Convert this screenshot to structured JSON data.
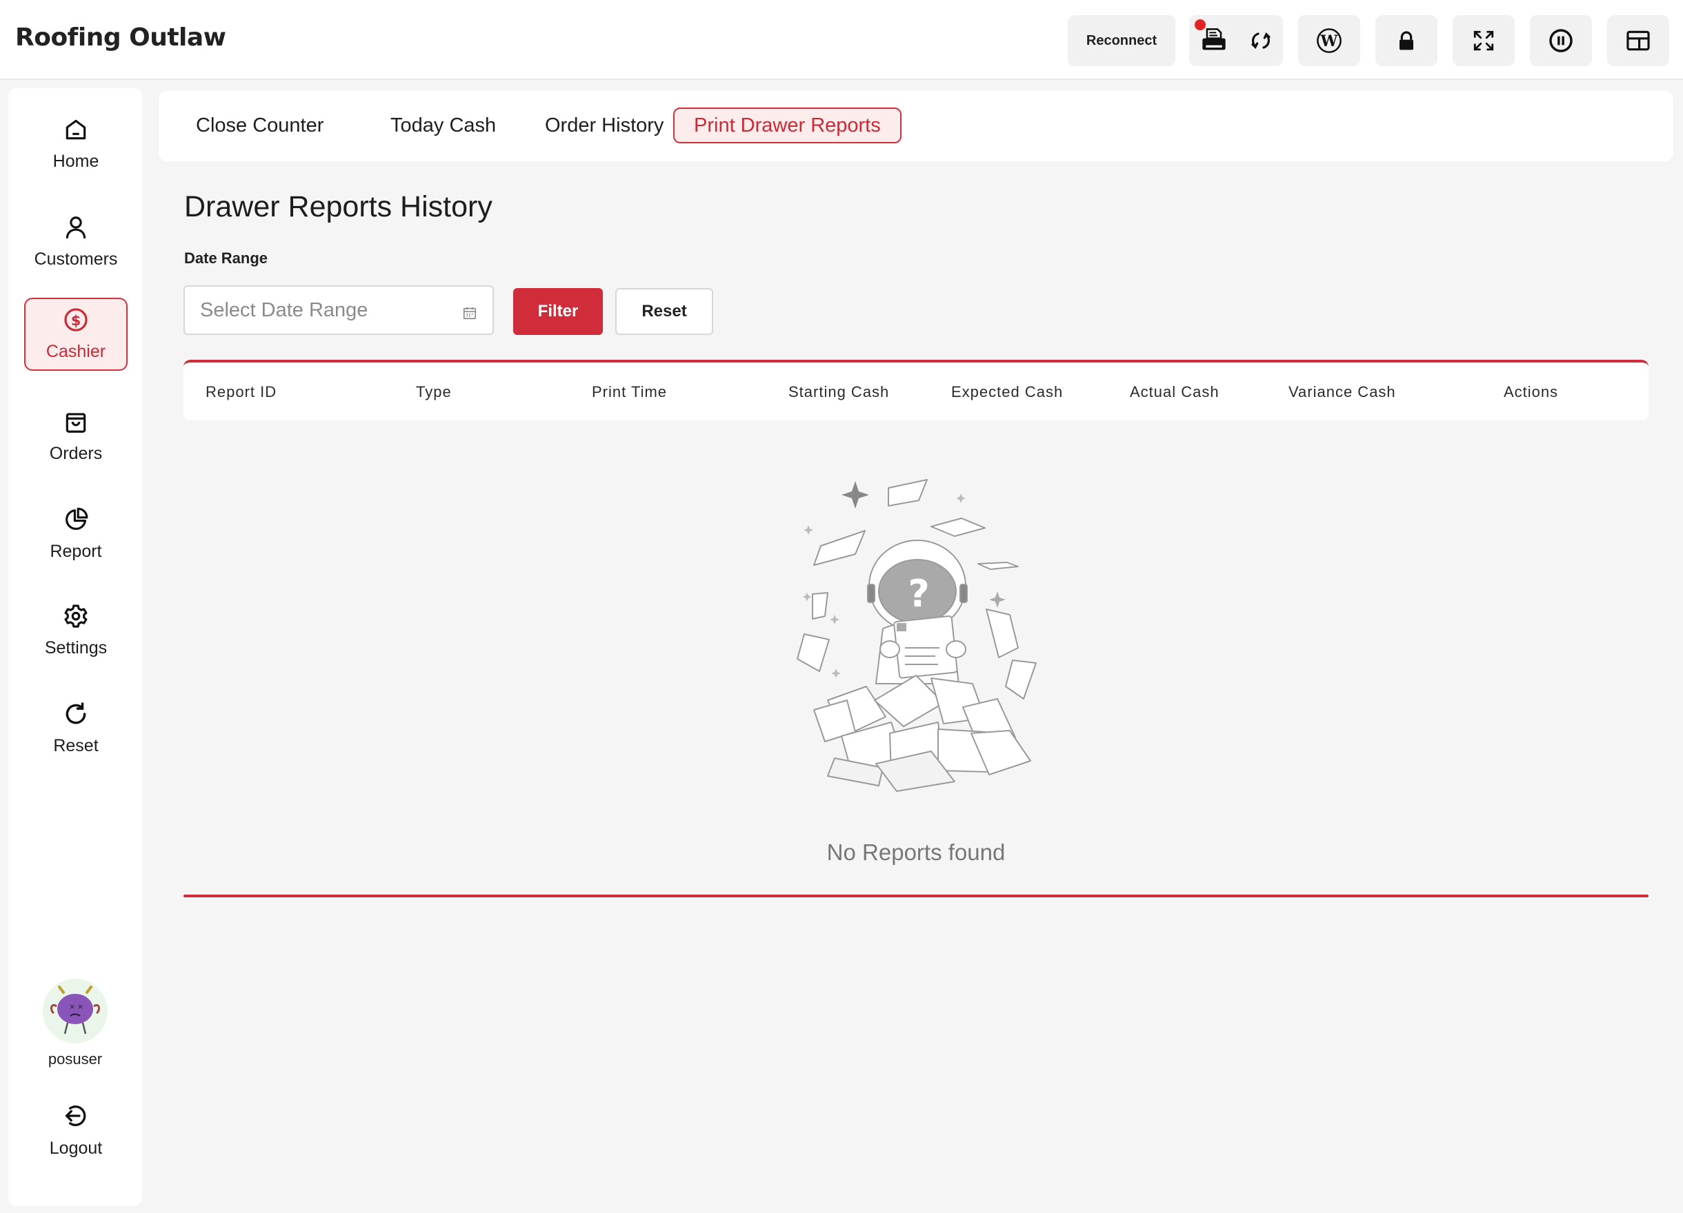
{
  "app": {
    "title": "Roofing Outlaw"
  },
  "toolbar": {
    "reconnect_label": "Reconnect",
    "icons": [
      "printer-icon",
      "sync-icon",
      "wordpress-icon",
      "lock-icon",
      "fullscreen-icon",
      "pause-icon",
      "layout-icon"
    ]
  },
  "sidebar": {
    "items": [
      {
        "label": "Home",
        "icon": "home-icon"
      },
      {
        "label": "Customers",
        "icon": "user-icon"
      },
      {
        "label": "Cashier",
        "icon": "dollar-circle-icon",
        "active": true
      },
      {
        "label": "Orders",
        "icon": "shopping-bag-icon"
      },
      {
        "label": "Report",
        "icon": "pie-chart-icon"
      },
      {
        "label": "Settings",
        "icon": "gear-icon"
      },
      {
        "label": "Reset",
        "icon": "refresh-icon"
      }
    ],
    "user": {
      "name": "posuser"
    },
    "logout_label": "Logout"
  },
  "tabs": [
    {
      "label": "Close Counter"
    },
    {
      "label": "Today Cash"
    },
    {
      "label": "Order History"
    },
    {
      "label": "Print Drawer Reports",
      "active": true
    }
  ],
  "main": {
    "title": "Drawer Reports History",
    "date_range_label": "Date Range",
    "date_placeholder": "Select Date Range",
    "filter_label": "Filter",
    "reset_label": "Reset",
    "columns": [
      "Report ID",
      "Type",
      "Print Time",
      "Starting Cash",
      "Expected Cash",
      "Actual Cash",
      "Variance Cash",
      "Actions"
    ],
    "rows": [],
    "empty_text": "No Reports found"
  },
  "colors": {
    "accent": "#d02c3a",
    "accent_bg": "#fdecec",
    "page_bg": "#f5f5f5"
  }
}
